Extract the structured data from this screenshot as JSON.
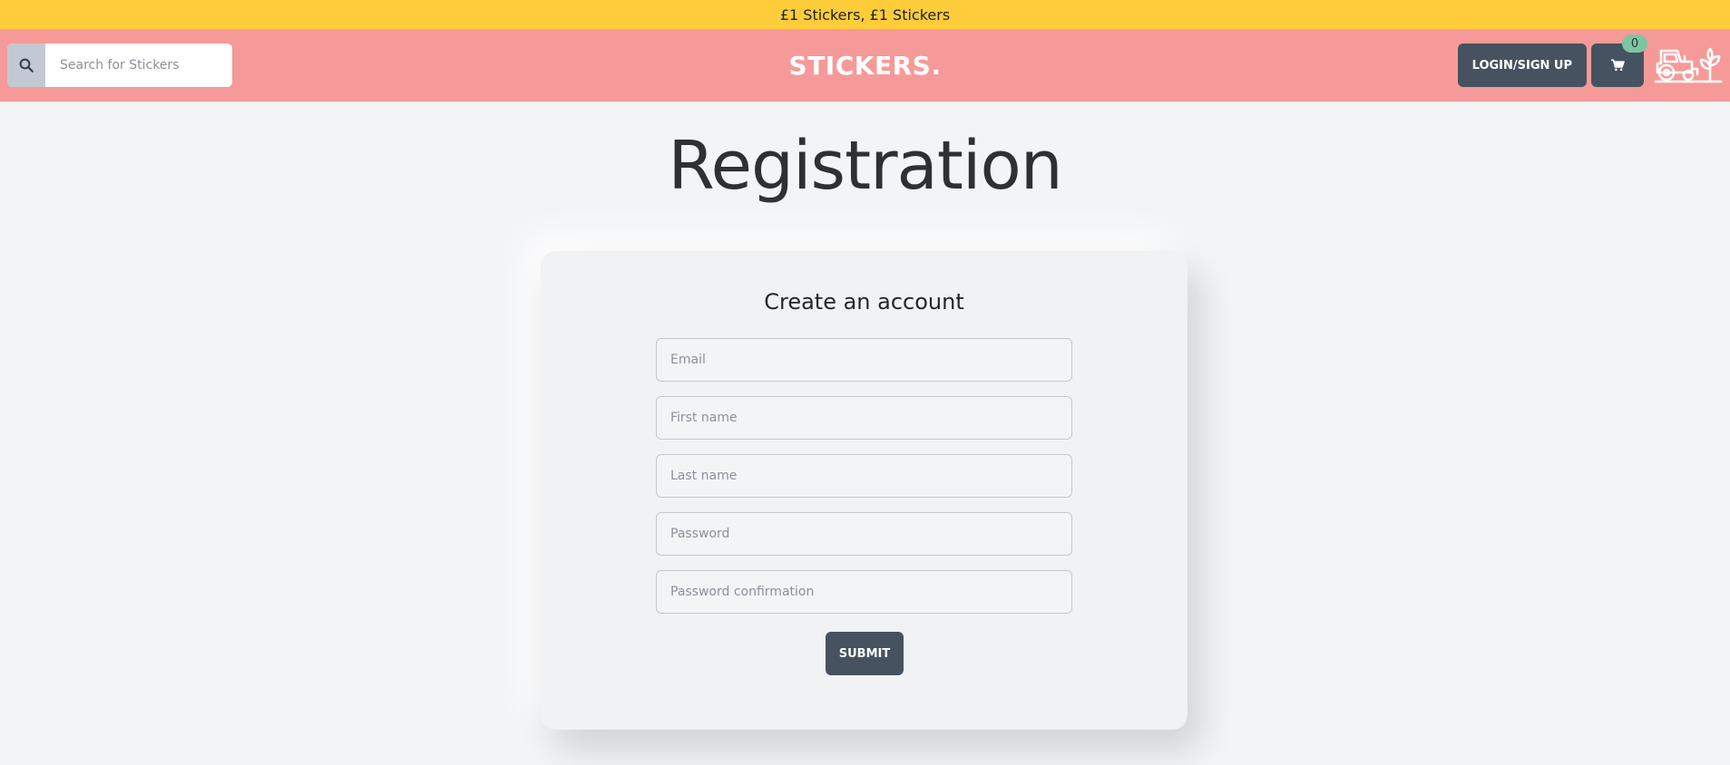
{
  "promo": {
    "text": "£1 Stickers, £1 Stickers"
  },
  "header": {
    "search_placeholder": "Search for Stickers",
    "logo": "STICKERS.",
    "login_label": "LOGIN/SIGN UP",
    "cart_count": "0"
  },
  "icons": {
    "search": "search-icon",
    "cart": "cart-icon",
    "farm": "tractor-plant-icon"
  },
  "page": {
    "title": "Registration"
  },
  "form": {
    "title": "Create an account",
    "fields": [
      {
        "placeholder": "Email",
        "value": ""
      },
      {
        "placeholder": "First name",
        "value": ""
      },
      {
        "placeholder": "Last name",
        "value": ""
      },
      {
        "placeholder": "Password",
        "value": ""
      },
      {
        "placeholder": "Password confirmation",
        "value": ""
      }
    ],
    "submit_label": "SUBMIT"
  },
  "colors": {
    "promo_bg": "#ffcc3a",
    "header_bg": "#f59a98",
    "button_bg": "#465260",
    "badge_bg": "#7ec4a0",
    "page_bg": "#f3f4f6"
  }
}
